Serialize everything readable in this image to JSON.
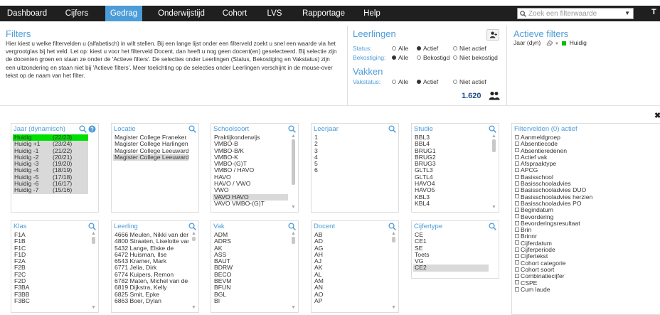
{
  "nav": {
    "items": [
      "Dashboard",
      "Cijfers",
      "Gedrag",
      "Onderwijstijd",
      "Cohort",
      "LVS",
      "Rapportage",
      "Help"
    ],
    "active": "Gedrag",
    "search_placeholder": "Zoek een filterwaarde",
    "extra": "T"
  },
  "filters": {
    "title": "Filters",
    "text": "Hier kiest u welke filtervelden u (alfabetisch) in wilt stellen. Bij een lange lijst onder een filterveld zoekt u snel een waarde via het vergrootglas bij het veld. Let op: kiest u voor het filterveld Docent, dan heeft u nog geen docent(en) geselecteerd. Bij selectie zijn de docenten groen en staan ze onder de 'Actieve filters'. De selecties onder Leerlingen (Status, Bekostiging en Vakstatus) zijn een uitzondering en staan niet bij 'Actieve filters'. Meer toelichting op de selecties onder Leerlingen verschijnt in de mouse-over tekst op de naam van het filter."
  },
  "leerlingen": {
    "title": "Leerlingen",
    "status_label": "Status:",
    "status_options": [
      "Alle",
      "Actief",
      "Niet actief"
    ],
    "status_selected": "Actief",
    "bekostiging_label": "Bekostiging:",
    "bekostiging_options": [
      "Alle",
      "Bekostigd",
      "Niet bekostigd"
    ],
    "bekostiging_selected": "Alle",
    "vakken_title": "Vakken",
    "vakstatus_label": "Vakstatus:",
    "vakstatus_options": [
      "Alle",
      "Actief",
      "Niet actief"
    ],
    "vakstatus_selected": "Actief",
    "count": "1.620"
  },
  "actieve": {
    "title": "Actieve filters",
    "item_label": "Jaar (dyn)",
    "item_value": "Huidig"
  },
  "lists": {
    "jaar": {
      "title": "Jaar (dynamisch)",
      "rows": [
        [
          "Huidig",
          "(22/23)"
        ],
        [
          "Huidig +1",
          "(23/24)"
        ],
        [
          "Huidig -1",
          "(21/22)"
        ],
        [
          "Huidig -2",
          "(20/21)"
        ],
        [
          "Huidig -3",
          "(19/20)"
        ],
        [
          "Huidig -4",
          "(18/19)"
        ],
        [
          "Huidig -5",
          "(17/18)"
        ],
        [
          "Huidig -6",
          "(16/17)"
        ],
        [
          "Huidig -7",
          "(15/16)"
        ]
      ]
    },
    "locatie": {
      "title": "Locatie",
      "rows": [
        "Magister College Franeker",
        "Magister College Harlingen",
        "Magister College Leeuwarden",
        "Magister College Leeuwarden"
      ]
    },
    "schoolsoort": {
      "title": "Schoolsoort",
      "rows": [
        "Praktijkonderwijs",
        "VMBO-B",
        "VMBO-B/K",
        "VMBO-K",
        "VMBO-(G)T",
        "VMBO / HAVO",
        "HAVO",
        "HAVO / VWO",
        "VWO",
        "VAVO HAVO",
        "VAVO VMBO-(G)T"
      ]
    },
    "leerjaar": {
      "title": "Leerjaar",
      "rows": [
        "1",
        "2",
        "3",
        "4",
        "5",
        "6"
      ]
    },
    "studie": {
      "title": "Studie",
      "rows": [
        "BBL3",
        "BBL4",
        "BRUG1",
        "BRUG2",
        "BRUG3",
        "GLTL3",
        "GLTL4",
        "HAVO4",
        "HAVO5",
        "KBL3",
        "KBL4"
      ]
    },
    "filtervelden": {
      "title": "Filtervelden (0) actief",
      "rows": [
        "Aanmeldgroep",
        "Absentiecode",
        "Absentieredenen",
        "Actief vak",
        "Afspraaktype",
        "APCG",
        "Basisschool",
        "Basisschooladvies",
        "Basisschooladvies DUO",
        "Basisschooladvies herzien",
        "Basisschooladvies PO",
        "Begindatum",
        "Bevordering",
        "Bevorderingsresultaat",
        "Brin",
        "Brinnr",
        "Cijferdatum",
        "Cijferperiode",
        "Cijfertekst",
        "Cohort categorie",
        "Cohort soort",
        "Combinatiecijfer",
        "CSPE",
        "Cum laude"
      ]
    },
    "klas": {
      "title": "Klas",
      "rows": [
        "F1A",
        "F1B",
        "F1C",
        "F1D",
        "F2A",
        "F2B",
        "F2C",
        "F2D",
        "F3BA",
        "F3BB",
        "F3BC"
      ]
    },
    "leerling": {
      "title": "Leerling",
      "rows": [
        "4666 Meulen, Nikki van der",
        "4800 Straaten, Liselotte van",
        "5432 Lange, Elske de",
        "6472 Huisman, Ilse",
        "6543 Kramer, Mark",
        "6771 Jelia, Dirk",
        "6774 Kuipers, Remon",
        "6782 Maten, Michel van der",
        "6819 Dijkstra, Kelly",
        "6825 Smit, Epke",
        "6863 Boer, Dylan"
      ]
    },
    "vak": {
      "title": "Vak",
      "rows": [
        "ADM",
        "ADRS",
        "AK",
        "ASS",
        "BAUT",
        "BDRW",
        "BECO",
        "BEVM",
        "BFUN",
        "BGL",
        "BI"
      ]
    },
    "docent": {
      "title": "Docent",
      "rows": [
        "AB",
        "AD",
        "AG",
        "AH",
        "AJ",
        "AK",
        "AL",
        "AM",
        "AN",
        "AO",
        "AP"
      ]
    },
    "cijfertype": {
      "title": "Cijfertype",
      "rows": [
        "CE",
        "CE1",
        "SE",
        "Toets",
        "VG",
        "CE2"
      ]
    }
  },
  "colors": {
    "accent": "#4c9cd8",
    "nav_bg": "#1f1f1f",
    "selected_green": "#00e000",
    "selected_grey": "#d9d9d9"
  }
}
